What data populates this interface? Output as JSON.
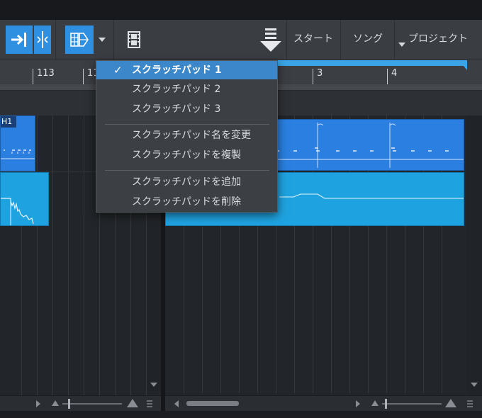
{
  "toolbar": {
    "start_label": "スタート",
    "song_label": "ソング",
    "project_label": "プロジェクト"
  },
  "ruler": {
    "left_labels": [
      "113",
      "11"
    ],
    "right_labels": [
      "3",
      "4"
    ]
  },
  "tracks": {
    "clip_label": "H1"
  },
  "scratchpad_menu": {
    "items": [
      {
        "label": "スクラッチパッド 1",
        "checked": true
      },
      {
        "label": "スクラッチパッド 2",
        "checked": false
      },
      {
        "label": "スクラッチパッド 3",
        "checked": false
      },
      {
        "label": "スクラッチパッド名を変更",
        "checked": false
      },
      {
        "label": "スクラッチパッドを複製",
        "checked": false
      },
      {
        "label": "スクラッチパッドを追加",
        "checked": false
      },
      {
        "label": "スクラッチパッドを削除",
        "checked": false
      }
    ],
    "check_glyph": "✓"
  },
  "icons": {
    "snap": "snap-to-end-icon",
    "split": "split-icon",
    "scratchpad": "scratchpad-icon",
    "video": "film-icon",
    "export": "download-arrow-icon"
  },
  "colors": {
    "accent": "#2f8fe0",
    "clip_blue": "#2a7fe0",
    "clip_cyan": "#1fa3e0",
    "menu_selected": "#3b87c9"
  }
}
